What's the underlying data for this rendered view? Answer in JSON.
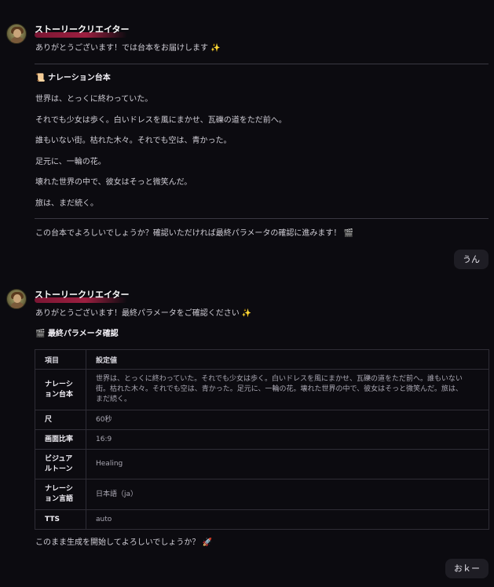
{
  "messages": [
    {
      "agent_name": "ストーリークリエイター",
      "intro": "ありがとうございます！では台本をお届けします",
      "script_heading": "ナレーション台本",
      "lines": [
        "世界は、とっくに終わっていた。",
        "それでも少女は歩く。白いドレスを風にまかせ、瓦礫の道をただ前へ。",
        "誰もいない街。枯れた木々。それでも空は、青かった。",
        "足元に、一輪の花。",
        "壊れた世界の中で、彼女はそっと微笑んだ。",
        "旅は、まだ続く。"
      ],
      "confirm": "この台本でよろしいでしょうか？確認いただければ最終パラメータの確認に進みます！"
    },
    {
      "agent_name": "ストーリークリエイター",
      "intro": "ありがとうございます！最終パラメータをご確認ください",
      "params_heading": "最終パラメータ確認",
      "table": {
        "headers": [
          "項目",
          "設定値"
        ],
        "rows": [
          {
            "key_l1": "ナレーシ",
            "key_l2": "ョン台本",
            "value_l1": "世界は、とっくに終わっていた。それでも少女は歩く。白いドレスを風にまかせ、瓦礫の道をただ前へ。誰もいない",
            "value_l2": "街。枯れた木々。それでも空は、青かった。足元に、一輪の花。壊れた世界の中で、彼女はそっと微笑んだ。旅は、",
            "value_l3": "まだ続く。"
          },
          {
            "key": "尺",
            "value": "60秒"
          },
          {
            "key": "画面比率",
            "value": "16:9"
          },
          {
            "key_l1": "ビジュア",
            "key_l2": "ルトーン",
            "value": "Healing"
          },
          {
            "key_l1": "ナレーシ",
            "key_l2": "ョン言語",
            "value": "日本語（ja）"
          },
          {
            "key": "TTS",
            "value": "auto"
          }
        ]
      },
      "confirm": "このまま生成を開始してよろしいでしょうか？"
    }
  ],
  "user_replies": [
    "うん",
    "おｋー"
  ],
  "icons": {
    "sparkle": "sparkles-icon",
    "scroll": "scroll-icon",
    "clapper": "clapper-board-icon",
    "rocket": "rocket-icon"
  }
}
